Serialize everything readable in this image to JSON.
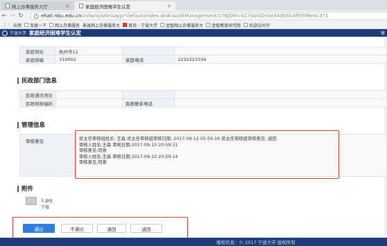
{
  "browser": {
    "tabs": [
      {
        "label": "网上办事服务大厅"
      },
      {
        "label": "家庭经济困难学生认定"
      }
    ],
    "url_host": "ehall.nbu.edu.cn",
    "url_path": "/xsfw/sys/knsapp/*default/index.do#/auditManagement/17BJDM=417dafd2e3e34d95b389596e4c371",
    "bookmarks": [
      {
        "label": "应用"
      },
      {
        "label": "百度一下"
      },
      {
        "label": "网上办事服务"
      },
      {
        "label": "景县网上办事服务大"
      },
      {
        "label": "首页 - 宁波大学"
      },
      {
        "label": "金智网上办事服务大"
      },
      {
        "label": "金智教育研究院"
      },
      {
        "label": "欢迎访问守"
      }
    ]
  },
  "app": {
    "school": "宁波大学",
    "title": "家庭经济困难学生认定",
    "right": "审"
  },
  "family": {
    "rows": [
      {
        "label": "家庭地址",
        "value": "杭州市12",
        "label2": "",
        "value2": ""
      },
      {
        "label": "家庭邮编",
        "value": "310002",
        "label2": "家庭电话",
        "value2": "1232323334"
      }
    ]
  },
  "civil": {
    "title": "民政部门信息",
    "rows": [
      {
        "label": "民政通讯地址",
        "value": "",
        "label2": "",
        "value2": ""
      },
      {
        "label": "民政邮政编码",
        "value": "",
        "label2": "民政联系电话",
        "value2": ""
      }
    ]
  },
  "manage": {
    "title": "管理信息",
    "review_label": "审核意见",
    "review_lines": [
      "班主任审核组姓名: 王森  班主任审核组审核日期: 2017-09-12 05:59:16  班主任审核组审核意见: 退回",
      "审核人姓名:王森  审核日期:2017-09-10 20:59:31",
      "审核意见:同意",
      "审核人姓名:王森  审核日期:2017-09-10 20:59:14",
      "审核意见:同意"
    ]
  },
  "attach": {
    "title": "附件",
    "file_name": "1.jpg",
    "download": "下载"
  },
  "actions": {
    "approve": "通过",
    "reject": "不通过",
    "return1": "退回",
    "return2": "返回"
  },
  "footer": {
    "text": "版权信息：© 2017 宁波大学 版权所有"
  },
  "colors": {
    "header": "#1e3d78",
    "primary": "#2f7de1",
    "highlight": "#e53935"
  }
}
